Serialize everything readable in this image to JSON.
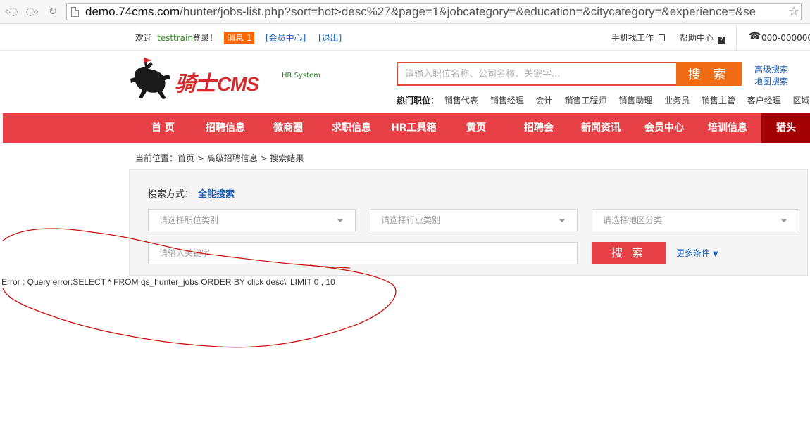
{
  "browser": {
    "url_host": "demo.74cms.com",
    "url_path": "/hunter/jobs-list.php?sort=hot>desc%27&page=1&jobcategory=&education=&citycategory=&experience=&se"
  },
  "topbar": {
    "welcome": "欢迎",
    "username": "testtrain",
    "logged_in": "登录！",
    "messages": "消息 1",
    "member_center": "[会员中心]",
    "logout": "[退出]",
    "mobile": "手机找工作",
    "help": "帮助中心",
    "phone": "000-000000"
  },
  "header": {
    "logo_text": "骑士",
    "logo_cms": "CMS",
    "logo_sub": "HR System",
    "search_placeholder": "请输入职位名称、公司名称、关键字...",
    "search_button": "搜 索",
    "advanced_search": "高级搜索",
    "map_search": "地图搜索",
    "hot_label": "热门职位：",
    "hot_jobs": [
      "销售代表",
      "销售经理",
      "会计",
      "销售工程师",
      "销售助理",
      "业务员",
      "销售主管",
      "客户经理",
      "区域销售"
    ]
  },
  "nav": {
    "items": [
      "首 页",
      "招聘信息",
      "微商圈",
      "求职信息",
      "HR工具箱",
      "黄页",
      "招聘会",
      "新闻资讯",
      "会员中心",
      "培训信息",
      "猎头"
    ]
  },
  "breadcrumb": "当前位置：首页 > 高级招聘信息 > 搜索结果",
  "search_panel": {
    "mode_label": "搜索方式：",
    "mode_value": "全能搜索",
    "job_category": "请选择职位类别",
    "industry": "请选择行业类别",
    "region": "请选择地区分类",
    "keyword_placeholder": "请输入关键字",
    "search_button": "搜 索",
    "more_conditions": "更多条件",
    "more_icon": "double-chevron-down-icon"
  },
  "error": "Error : Query error:SELECT * FROM qs_hunter_jobs ORDER BY click desc\\' LIMIT 0 , 10",
  "colors": {
    "nav_red": "#e64046",
    "nav_active": "#a30004",
    "search_orange": "#f06d16",
    "annotation_red": "#cc1111"
  }
}
